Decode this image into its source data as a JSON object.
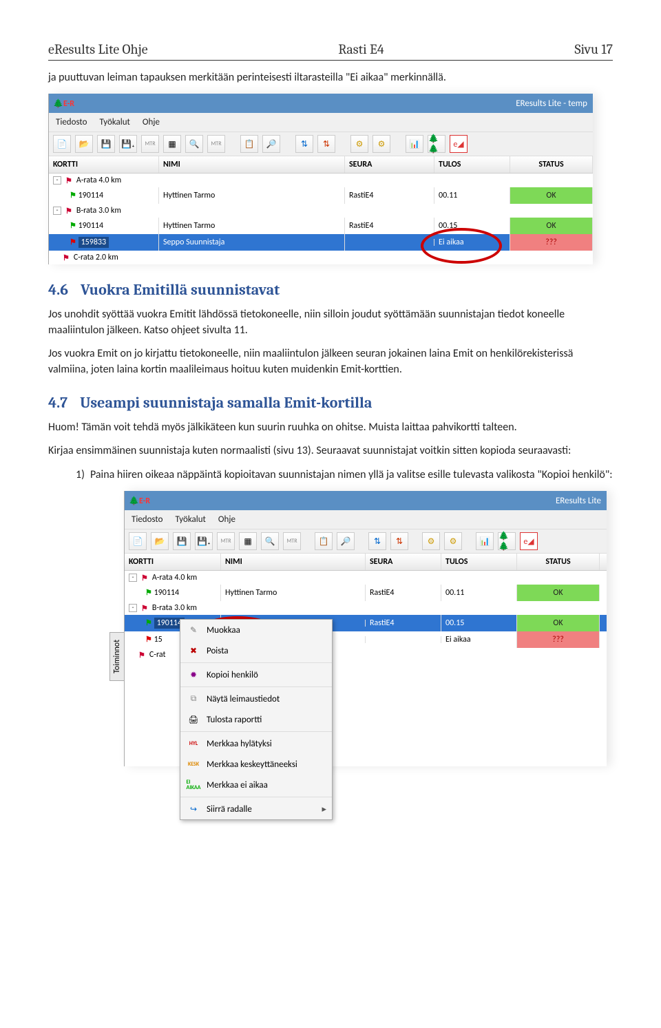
{
  "header": {
    "left": "eResults Lite Ohje",
    "center": "Rasti E4",
    "right": "Sivu 17"
  },
  "intro": "ja puuttuvan leiman tapauksen merkitään perinteisesti iltarasteilla \"Ei aikaa\" merkinnällä.",
  "app": {
    "title": "EResults Lite - temp",
    "logo_hint": "E-R",
    "menus": [
      "Tiedosto",
      "Työkalut",
      "Ohje"
    ],
    "columns": [
      "KORTTI",
      "NIMI",
      "SEURA",
      "TULOS",
      "STATUS"
    ]
  },
  "shot1": {
    "tree": [
      {
        "type": "class",
        "label": "A-rata 4.0 km",
        "exp": "-"
      },
      {
        "type": "runner",
        "card": "190114",
        "name": "Hyttinen Tarmo",
        "seura": "RastiE4",
        "tulos": "00.11",
        "status": "OK",
        "statusClass": "ok"
      },
      {
        "type": "class",
        "label": "B-rata 3.0 km",
        "exp": "-"
      },
      {
        "type": "runner",
        "card": "190114",
        "name": "Hyttinen Tarmo",
        "seura": "RastiE4",
        "tulos": "00.15",
        "status": "OK",
        "statusClass": "ok"
      },
      {
        "type": "runner",
        "card": "159833",
        "name": "Seppo Suunnistaja",
        "seura": "",
        "tulos": "Ei aikaa",
        "status": "???",
        "statusClass": "err",
        "selected": true
      },
      {
        "type": "class",
        "label": "C-rata 2.0 km",
        "exp": ""
      }
    ]
  },
  "s46": {
    "num": "4.6",
    "title": "Vuokra Emitillä suunnistavat",
    "p1": "Jos unohdit syöttää vuokra Emitit lähdössä tietokoneelle, niin silloin joudut syöttämään suunnistajan tiedot koneelle maaliintulon jälkeen. Katso ohjeet sivulta 11.",
    "p2": "Jos vuokra Emit on jo kirjattu tietokoneelle, niin maaliintulon jälkeen seuran jokainen laina Emit on henkilörekisterissä valmiina, joten laina kortin maalileimaus hoituu kuten muidenkin Emit-korttien."
  },
  "s47": {
    "num": "4.7",
    "title": "Useampi suunnistaja samalla Emit-kortilla",
    "p1": "Huom! Tämän voit tehdä myös jälkikäteen kun suurin ruuhka on ohitse. Muista laittaa pahvikortti talteen.",
    "p2": "Kirjaa ensimmäinen suunnistaja kuten normaalisti (sivu 13). Seuraavat suunnistajat voitkin sitten kopioda seuraavasti:",
    "li1_num": "1)",
    "li1": "Paina hiiren oikeaa näppäintä kopioitavan suunnistajan nimen yllä ja valitse esille tulevasta valikosta \"Kopioi henkilö\":"
  },
  "app2": {
    "title": "EResults Lite"
  },
  "shot2": {
    "rows": [
      {
        "type": "class",
        "label": "A-rata 4.0 km",
        "exp": "-"
      },
      {
        "type": "runner",
        "card": "190114",
        "name": "Hyttinen Tarmo",
        "seura": "RastiE4",
        "tulos": "00.11",
        "status": "OK",
        "statusClass": "ok"
      },
      {
        "type": "class",
        "label": "B-rata 3.0 km",
        "exp": "-"
      },
      {
        "type": "runner_sel",
        "card": "190114",
        "name": "",
        "seura": "RastiE4",
        "tulos": "00.15",
        "status": "OK",
        "statusClass": "ok",
        "selected": true
      },
      {
        "type": "runner",
        "card": "15",
        "name": "",
        "seura": "",
        "tulos": "Ei aikaa",
        "status": "???",
        "statusClass": "err"
      },
      {
        "type": "class",
        "label": "C-rat",
        "exp": ""
      }
    ],
    "contextmenu_tab": "Toiminnot",
    "contextmenu": [
      {
        "icon": "✎",
        "label": "Muokkaa",
        "hot": true
      },
      {
        "icon": "🗑",
        "label": "Poista",
        "hot": true
      },
      {
        "sep": true
      },
      {
        "icon": "👤",
        "label": "Kopioi henkilö"
      },
      {
        "sep": true
      },
      {
        "icon": "🕒",
        "label": "Näytä leimaustiedot"
      },
      {
        "icon": "🖨",
        "label": "Tulosta raportti"
      },
      {
        "sep": true
      },
      {
        "icon": "HYL",
        "iconColor": "#c00",
        "label": "Merkkaa hylätyksi"
      },
      {
        "icon": "KESK",
        "iconColor": "#d80",
        "label": "Merkkaa keskeyttäneeksi"
      },
      {
        "icon": "EI",
        "iconColor": "#0a0",
        "label": "Merkkaa ei aikaa",
        "sub": "AIKAA"
      },
      {
        "sep": true
      },
      {
        "icon": "➜",
        "label": "Siirrä radalle",
        "arrow": "▸"
      }
    ]
  },
  "icons": {
    "class": "⚑",
    "runner_ok": "⚑",
    "runner_sel": "⚑"
  }
}
